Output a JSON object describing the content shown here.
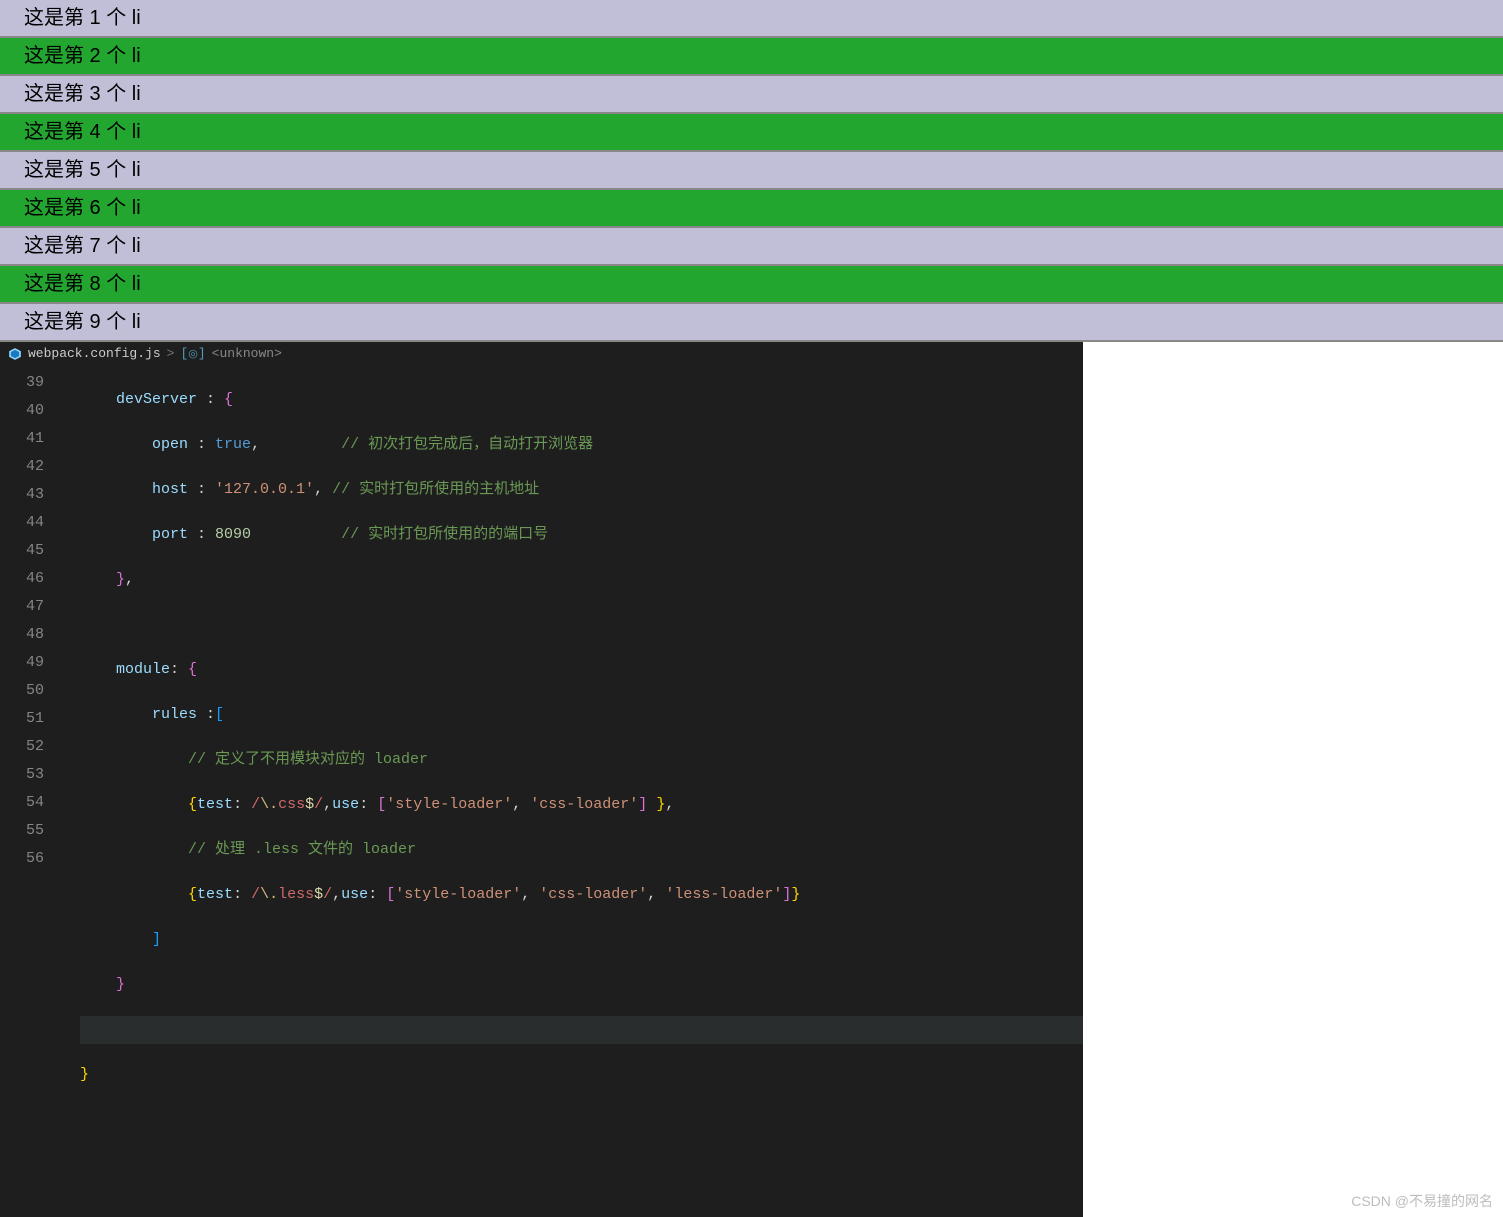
{
  "list": {
    "items": [
      "这是第 1 个 li",
      "这是第 2 个 li",
      "这是第 3 个 li",
      "这是第 4 个 li",
      "这是第 5 个 li",
      "这是第 6 个 li",
      "这是第 7 个 li",
      "这是第 8 个 li",
      "这是第 9 个 li"
    ]
  },
  "editor": {
    "breadcrumb": {
      "file": "webpack.config.js",
      "sep": ">",
      "symbol": "<unknown>"
    },
    "line_numbers": [
      "39",
      "40",
      "41",
      "42",
      "43",
      "44",
      "45",
      "46",
      "47",
      "48",
      "49",
      "50",
      "51",
      "52",
      "53",
      "54",
      "55",
      "56"
    ],
    "code": {
      "l39": {
        "key": "devServer",
        "colon": " : ",
        "brace": "{"
      },
      "l40": {
        "key": "open",
        "colon": " : ",
        "val": "true",
        "comma": ",",
        "comment": "// 初次打包完成后，自动打开浏览器"
      },
      "l41": {
        "key": "host",
        "colon": " : ",
        "val": "'127.0.0.1'",
        "comma": ",",
        "comment": "// 实时打包所使用的主机地址"
      },
      "l42": {
        "key": "port",
        "colon": " : ",
        "val": "8090",
        "comment": "// 实时打包所使用的的端口号"
      },
      "l43": {
        "brace": "}",
        "comma": ","
      },
      "l45": {
        "key": "module",
        "colon": ": ",
        "brace": "{"
      },
      "l46": {
        "key": "rules",
        "colon": " :",
        "bracket": "["
      },
      "l47": {
        "comment": "// 定义了不用模块对应的 loader"
      },
      "l48": {
        "obrace": "{",
        "k1": "test",
        "c1": ": ",
        "rx_open": "/",
        "rx_esc": "\\.",
        "rx_body": "css",
        "rx_anch": "$",
        "rx_close": "/",
        "comma1": ",",
        "k2": "use",
        "c2": ": ",
        "ob": "[",
        "s1": "'style-loader'",
        "cc1": ", ",
        "s2": "'css-loader'",
        "cb": "]",
        "sp": " ",
        "cbrace": "}",
        "comma2": ","
      },
      "l49": {
        "comment": "// 处理 .less 文件的 loader"
      },
      "l50": {
        "obrace": "{",
        "k1": "test",
        "c1": ": ",
        "rx_open": "/",
        "rx_esc": "\\.",
        "rx_body": "less",
        "rx_anch": "$",
        "rx_close": "/",
        "comma1": ",",
        "k2": "use",
        "c2": ": ",
        "ob": "[",
        "s1": "'style-loader'",
        "cc1": ", ",
        "s2": "'css-loader'",
        "cc2": ", ",
        "s3": "'less-loader'",
        "cb": "]",
        "cbrace": "}"
      },
      "l51": {
        "bracket": "]"
      },
      "l52": {
        "brace": "}"
      },
      "l54": {
        "brace": "}"
      }
    }
  },
  "watermark": "CSDN @不易撞的网名"
}
